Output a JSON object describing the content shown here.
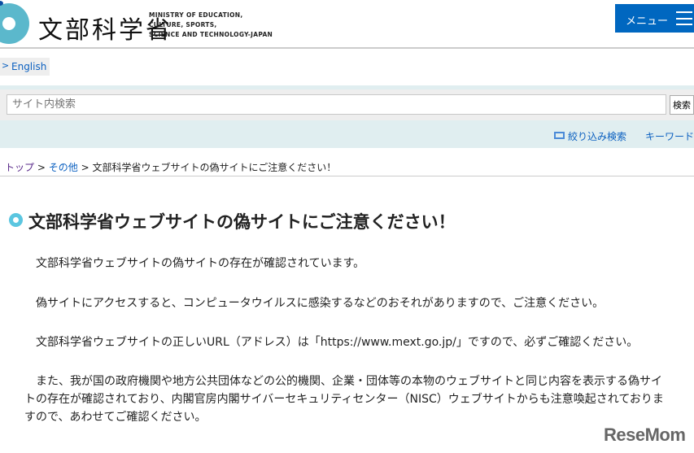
{
  "header": {
    "logo_jp": "文部科学省",
    "logo_en": [
      "MINISTRY OF EDUCATION,",
      "CULTURE, SPORTS,",
      "SCIENCE AND TECHNOLOGY-JAPAN"
    ],
    "menu_label": "メニュー"
  },
  "lang_link": "English",
  "search": {
    "placeholder": "サイト内検索",
    "button": "検索",
    "filter_link": "絞り込み検索",
    "keyword_link": "キーワード"
  },
  "breadcrumb": {
    "items": [
      "トップ",
      "その他"
    ],
    "current": "文部科学省ウェブサイトの偽サイトにご注意ください！",
    "sep": ">"
  },
  "article": {
    "title": "文部科学省ウェブサイトの偽サイトにご注意ください！",
    "paragraphs": [
      "　文部科学省ウェブサイトの偽サイトの存在が確認されています。",
      "　偽サイトにアクセスすると、コンピュータウイルスに感染するなどのおそれがありますので、ご注意ください。",
      "　文部科学省ウェブサイトの正しいURL（アドレス）は「https://www.mext.go.jp/」ですので、必ずご確認ください。",
      "　また、我が国の政府機関や地方公共団体などの公的機関、企業・団体等の本物のウェブサイトと同じ内容を表示する偽サイトの存在が確認されており、内閣官房内閣サイバーセキュリティセンター（NISC）ウェブサイトからも注意喚起されておりますので、あわせてご確認ください。"
    ]
  },
  "watermark": "ReseMom"
}
